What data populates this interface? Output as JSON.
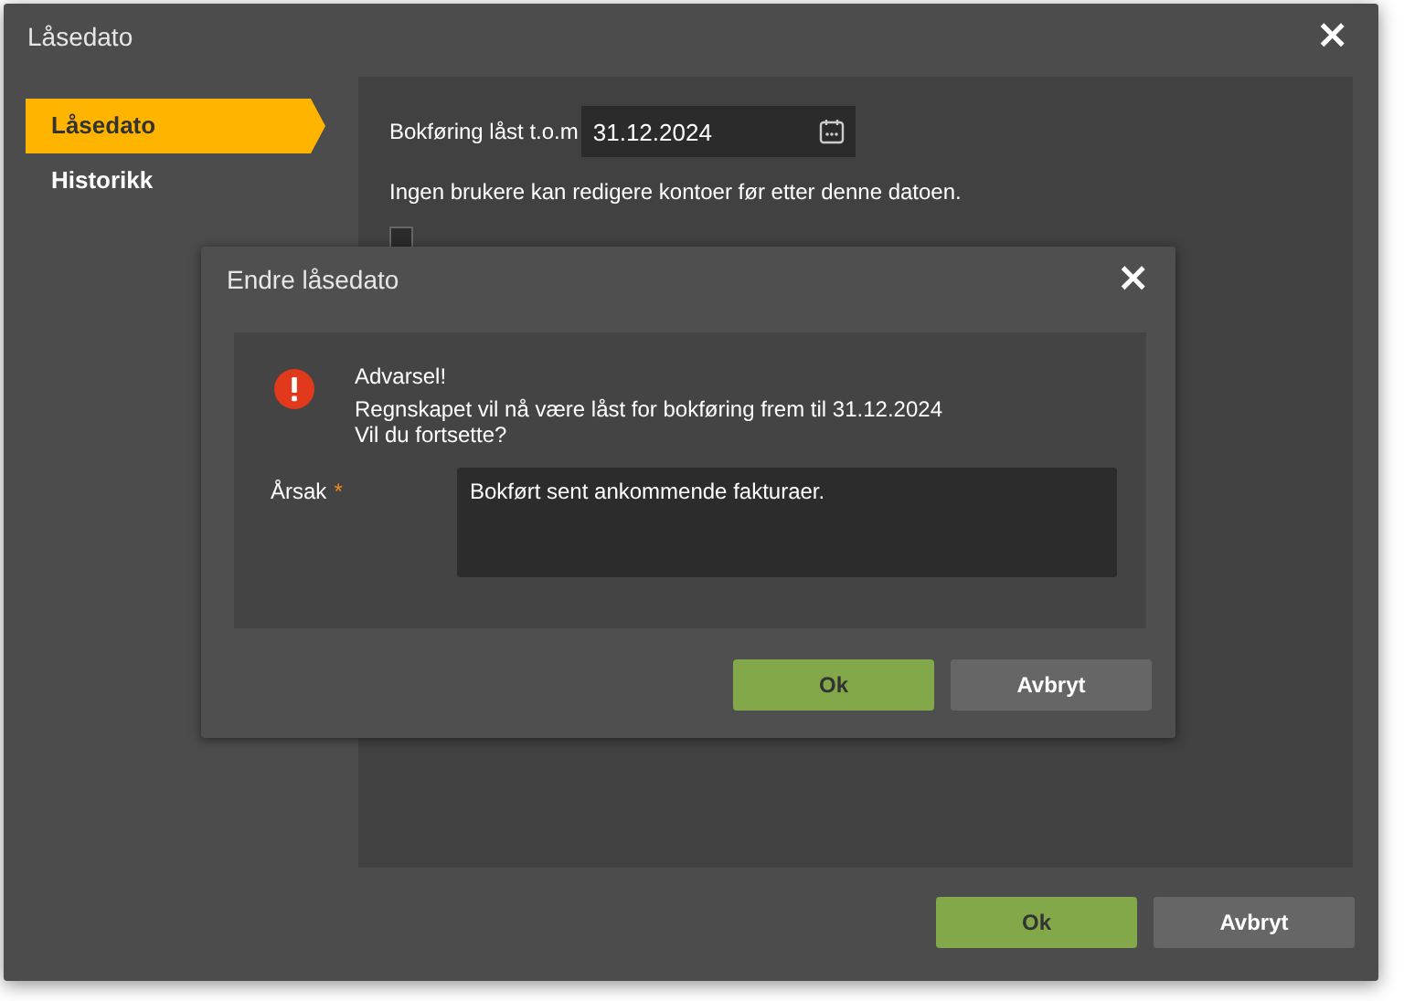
{
  "window": {
    "title": "Låsedato",
    "close": "×"
  },
  "sidebar": {
    "items": [
      {
        "label": "Låsedato",
        "selected": true
      },
      {
        "label": "Historikk",
        "selected": false
      }
    ]
  },
  "content": {
    "date_label": "Bokføring låst t.o.m",
    "date_value": "31.12.2024",
    "info": "Ingen brukere kan redigere kontoer før etter denne datoen.",
    "checkbox": {
      "checked": false
    }
  },
  "buttons": [
    {
      "label": "Ok",
      "kind": "primary"
    },
    {
      "label": "Avbryt",
      "kind": "secondary"
    }
  ],
  "dialog": {
    "title": "Endre låsedato",
    "close": "×",
    "warning": {
      "heading": "Advarsel!",
      "lines": [
        "Regnskapet vil nå være låst for bokføring frem til 31.12.2024",
        "Vil du fortsette?"
      ]
    },
    "reason": {
      "label": "Årsak",
      "required_mark": "*",
      "value": "Bokført sent ankommende fakturaer."
    },
    "buttons": [
      {
        "label": "Ok",
        "kind": "primary"
      },
      {
        "label": "Avbryt",
        "kind": "secondary"
      }
    ]
  }
}
